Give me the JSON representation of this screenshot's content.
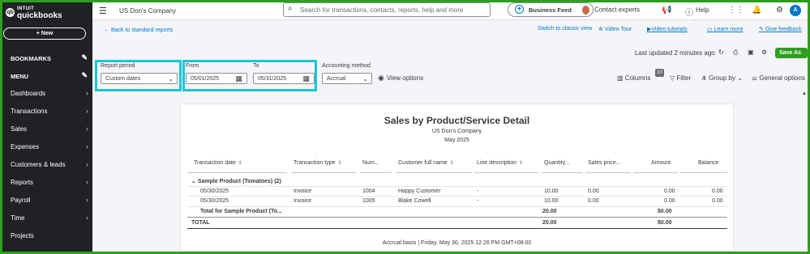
{
  "brand": {
    "intuit": "INTUIT",
    "product": "quickbooks",
    "accent": "#2ca01c",
    "highlight": "#19c6d8"
  },
  "sidebar": {
    "new_label": "+ New",
    "bookmarks": "BOOKMARKS",
    "menu": "MENU",
    "items": [
      {
        "label": "Dashboards"
      },
      {
        "label": "Transactions"
      },
      {
        "label": "Sales"
      },
      {
        "label": "Expenses"
      },
      {
        "label": "Customers & leads"
      },
      {
        "label": "Reports"
      },
      {
        "label": "Payroll"
      },
      {
        "label": "Time"
      },
      {
        "label": "Projects"
      }
    ]
  },
  "topbar": {
    "company": "US Don's Company",
    "search_placeholder": "Search for transactions, contacts, reports, help and more",
    "business_feed": "Business Feed",
    "contact_experts": "Contact experts",
    "help": "Help",
    "user_initial": "A"
  },
  "subnav": {
    "back": "Back to standard reports",
    "classic": "Switch to classic view",
    "video_tour": "Video Tour",
    "video_tutorials": "Video tutorials",
    "learn_more": "Learn more",
    "give_feedback": "Give feedback"
  },
  "filters": {
    "report_period_label": "Report period",
    "report_period_value": "Custom dates",
    "from_label": "From",
    "from_value": "05/01/2025",
    "to_label": "To",
    "to_value": "05/31/2025",
    "method_label": "Accounting method",
    "method_value": "Accrual",
    "view_options": "View options"
  },
  "toolbar": {
    "last_updated": "Last updated 2 minutes ago",
    "save_as": "Save As",
    "columns": "Columns",
    "columns_count": "10",
    "filter": "Filter",
    "group_by": "Group by",
    "general_options": "General options"
  },
  "report": {
    "title": "Sales by Product/Service Detail",
    "company": "US Don's Company",
    "period": "May 2025",
    "columns": [
      "Transaction date",
      "Transaction type",
      "Num...",
      "Customer full name",
      "Line description",
      "Quantity...",
      "Sales price...",
      "Amount",
      "Balance"
    ],
    "group_label": "Sample Product (Tomatoes) (2)",
    "rows": [
      {
        "date": "05/30/2025",
        "type": "Invoice",
        "num": "1004",
        "customer": "Happy Customer",
        "desc": "-",
        "qty": "10.00",
        "price": "0.00",
        "amount": "0.00",
        "balance": "0.00"
      },
      {
        "date": "05/30/2025",
        "type": "Invoice",
        "num": "1005",
        "customer": "Blake Cowell",
        "desc": "-",
        "qty": "10.00",
        "price": "0.00",
        "amount": "0.00",
        "balance": "0.00"
      }
    ],
    "subtotal_label": "Total for Sample Product (To...",
    "subtotal_qty": "20.00",
    "subtotal_amount": "$0.00",
    "total_label": "TOTAL",
    "total_qty": "20.00",
    "total_amount": "$0.00",
    "footer": "Accrual basis  |  Friday, May 30, 2025 12:26 PM GMT+08:00"
  }
}
